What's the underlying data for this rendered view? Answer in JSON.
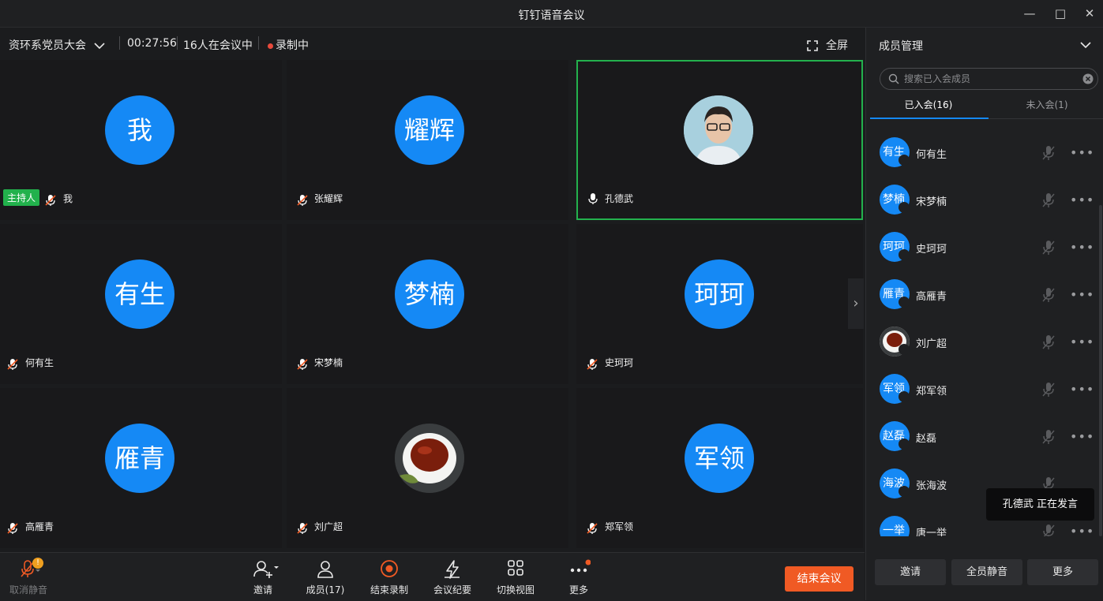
{
  "window": {
    "title": "钉钉语音会议"
  },
  "meeting": {
    "name": "资环系党员大会",
    "duration": "00:27:56",
    "participants": "16人在会议中",
    "recording": "录制中",
    "fullscreen_label": "全屏"
  },
  "tiles": [
    {
      "avatar": "我",
      "name": "我",
      "host_badge": "主持人",
      "mic": "muted"
    },
    {
      "avatar": "耀辉",
      "name": "张耀辉",
      "mic": "muted"
    },
    {
      "avatar": "",
      "name": "孔德武",
      "mic": "on",
      "photo": "person"
    },
    {
      "avatar": "有生",
      "name": "何有生",
      "mic": "muted"
    },
    {
      "avatar": "梦楠",
      "name": "宋梦楠",
      "mic": "muted"
    },
    {
      "avatar": "珂珂",
      "name": "史珂珂",
      "mic": "muted"
    },
    {
      "avatar": "雁青",
      "name": "高雁青",
      "mic": "muted"
    },
    {
      "avatar": "",
      "name": "刘广超",
      "mic": "muted",
      "photo": "tea"
    },
    {
      "avatar": "军领",
      "name": "郑军领",
      "mic": "muted"
    }
  ],
  "toolbar": {
    "unmute": "取消静音",
    "unmute_badge": "!",
    "invite": "邀请",
    "members": "成员(17)",
    "end_recording": "结束录制",
    "minutes": "会议纪要",
    "switch_view": "切换视图",
    "more": "更多",
    "end_meeting": "结束会议"
  },
  "panel": {
    "title": "成员管理",
    "search_placeholder": "搜索已入会成员",
    "tab_joined": "已入会(16)",
    "tab_not_joined": "未入会(1)",
    "members": [
      {
        "avatar": "有生",
        "name": "何有生"
      },
      {
        "avatar": "梦楠",
        "name": "宋梦楠"
      },
      {
        "avatar": "珂珂",
        "name": "史珂珂"
      },
      {
        "avatar": "雁青",
        "name": "高雁青"
      },
      {
        "avatar": "",
        "name": "刘广超",
        "photo": "tea"
      },
      {
        "avatar": "军领",
        "name": "郑军领"
      },
      {
        "avatar": "赵磊",
        "name": "赵磊"
      },
      {
        "avatar": "海波",
        "name": "张海波"
      },
      {
        "avatar": "一举",
        "name": "唐一举"
      }
    ],
    "speaking_toast": "孔德武  正在发言",
    "invite_btn": "邀请",
    "mute_all_btn": "全员静音",
    "more_btn": "更多"
  },
  "colors": {
    "accent": "#1589f5",
    "danger": "#f05a24",
    "active": "#23b14d",
    "host": "#22b14c"
  }
}
